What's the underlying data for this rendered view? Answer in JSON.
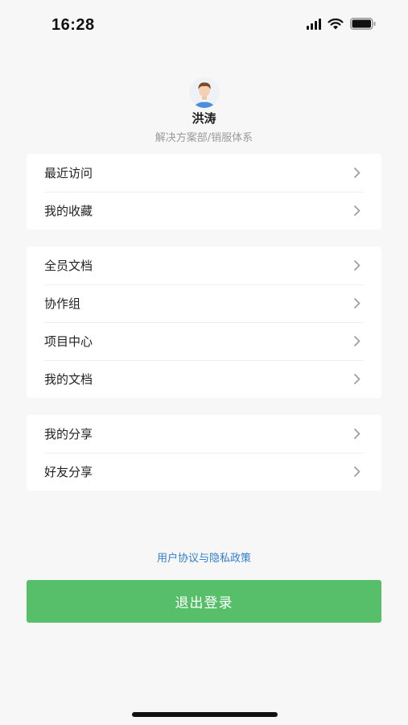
{
  "status_bar": {
    "time": "16:28",
    "icons": [
      "signal-icon",
      "wifi-icon",
      "battery-icon"
    ]
  },
  "profile": {
    "avatar_icon": "user-avatar-icon",
    "name": "洪涛",
    "department": "解决方案部/销服体系"
  },
  "menu_groups": [
    {
      "items": [
        {
          "label": "最近访问",
          "icon": "chevron-right-icon"
        },
        {
          "label": "我的收藏",
          "icon": "chevron-right-icon"
        }
      ]
    },
    {
      "items": [
        {
          "label": "全员文档",
          "icon": "chevron-right-icon"
        },
        {
          "label": "协作组",
          "icon": "chevron-right-icon"
        },
        {
          "label": "项目中心",
          "icon": "chevron-right-icon"
        },
        {
          "label": "我的文档",
          "icon": "chevron-right-icon"
        }
      ]
    },
    {
      "items": [
        {
          "label": "我的分享",
          "icon": "chevron-right-icon"
        },
        {
          "label": "好友分享",
          "icon": "chevron-right-icon"
        }
      ]
    }
  ],
  "footer": {
    "policy_link": "用户协议与隐私政策",
    "logout_label": "退出登录"
  },
  "colors": {
    "background": "#f7f7f7",
    "accent_green": "#57bf6a",
    "link_blue": "#2f7fd1"
  }
}
